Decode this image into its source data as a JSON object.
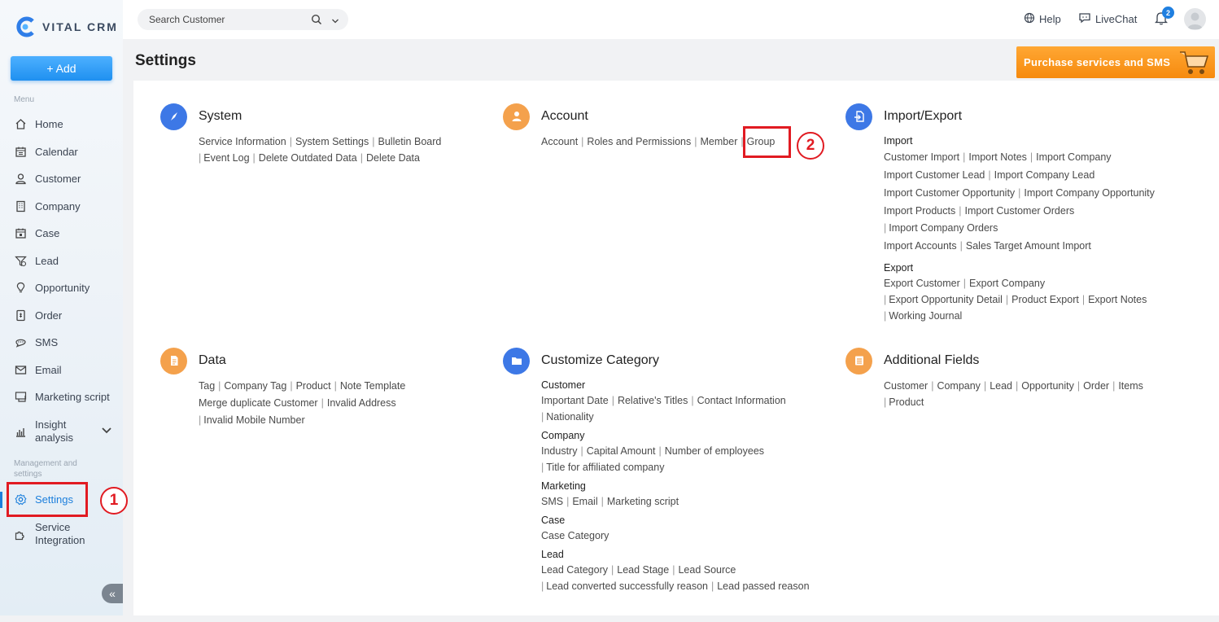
{
  "app": {
    "logo_text": "VITAL CRM",
    "add_label": "+ Add",
    "menu_label": "Menu",
    "mgmt_label": "Management and settings",
    "collapse_glyph": "«"
  },
  "nav": {
    "home": "Home",
    "calendar": "Calendar",
    "customer": "Customer",
    "company": "Company",
    "case": "Case",
    "lead": "Lead",
    "opportunity": "Opportunity",
    "order": "Order",
    "sms": "SMS",
    "email": "Email",
    "marketing_script": "Marketing script",
    "insight_1": "Insight",
    "insight_2": "analysis",
    "settings": "Settings",
    "service_1": "Service",
    "service_2": "Integration"
  },
  "topbar": {
    "search_placeholder": "Search Customer",
    "help": "Help",
    "livechat": "LiveChat",
    "notification_count": "2"
  },
  "page": {
    "title": "Settings",
    "purchase_label": "Purchase services and SMS"
  },
  "annotations": {
    "step1": "1",
    "step2": "2"
  },
  "cards": {
    "system": {
      "title": "System",
      "lines": [
        [
          "Service Information",
          "System Settings",
          "Bulletin Board"
        ],
        [
          "Event Log",
          "Delete Outdated Data",
          "Delete Data"
        ]
      ]
    },
    "account": {
      "title": "Account",
      "links": [
        "Account",
        "Roles and Permissions",
        "Member",
        "Group"
      ]
    },
    "import_export": {
      "title": "Import/Export",
      "import_head": "Import",
      "import_lines": [
        [
          "Customer Import",
          "Import Notes",
          "Import Company"
        ],
        [
          "Import Customer Lead",
          "Import Company Lead"
        ],
        [
          "Import Customer Opportunity",
          "Import Company Opportunity"
        ],
        [
          "Import Products",
          "Import Customer Orders"
        ],
        [
          "Import Company Orders"
        ],
        [
          "Import Accounts",
          "Sales Target Amount Import"
        ]
      ],
      "export_head": "Export",
      "export_lines": [
        [
          "Export Customer",
          "Export Company"
        ],
        [
          "Export Opportunity Detail",
          "Product Export",
          "Export Notes"
        ],
        [
          "Working Journal"
        ]
      ]
    },
    "data": {
      "title": "Data",
      "lines": [
        [
          "Tag",
          "Company Tag",
          "Product",
          "Note Template"
        ],
        [
          "Merge duplicate Customer",
          "Invalid Address"
        ],
        [
          "Invalid Mobile Number"
        ]
      ]
    },
    "customize": {
      "title": "Customize Category",
      "groups": [
        {
          "head": "Customer",
          "lines": [
            [
              "Important Date",
              "Relative's Titles",
              "Contact Information"
            ],
            [
              "Nationality"
            ]
          ]
        },
        {
          "head": "Company",
          "lines": [
            [
              "Industry",
              "Capital Amount",
              "Number of employees"
            ],
            [
              "Title for affiliated company"
            ]
          ]
        },
        {
          "head": "Marketing",
          "lines": [
            [
              "SMS",
              "Email",
              "Marketing script"
            ]
          ]
        },
        {
          "head": "Case",
          "lines": [
            [
              "Case Category"
            ]
          ]
        },
        {
          "head": "Lead",
          "lines": [
            [
              "Lead Category",
              "Lead Stage",
              "Lead Source"
            ],
            [
              "Lead converted successfully reason",
              "Lead passed reason"
            ]
          ]
        }
      ]
    },
    "additional": {
      "title": "Additional Fields",
      "lines": [
        [
          "Customer",
          "Company",
          "Lead",
          "Opportunity",
          "Order",
          "Items"
        ],
        [
          "Product"
        ]
      ]
    }
  },
  "colors": {
    "accent_blue": "#1c7fdc",
    "icon_blue": "#3d78e6",
    "icon_orange": "#f4a14c",
    "purchase_orange": "#f68a0e",
    "annotation_red": "#e11b22"
  }
}
